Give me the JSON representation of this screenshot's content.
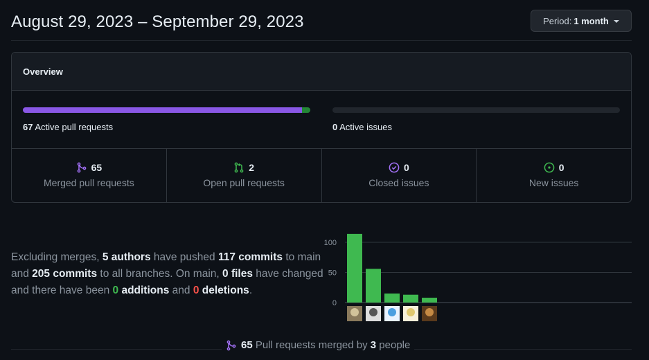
{
  "date_range": "August 29, 2023 – September 29, 2023",
  "period": {
    "prefix": "Period:",
    "value": "1 month"
  },
  "overview": {
    "title": "Overview",
    "pull_requests": {
      "count": "67",
      "label": "Active pull requests",
      "merged_fraction": 0.97,
      "open_fraction": 0.03
    },
    "issues": {
      "count": "0",
      "label": "Active issues"
    },
    "stats": [
      {
        "value": "65",
        "label": "Merged pull requests",
        "icon": "git-merge-icon",
        "color": "#a371f7"
      },
      {
        "value": "2",
        "label": "Open pull requests",
        "icon": "git-pull-request-icon",
        "color": "#3fb950"
      },
      {
        "value": "0",
        "label": "Closed issues",
        "icon": "issue-closed-icon",
        "color": "#a371f7"
      },
      {
        "value": "0",
        "label": "New issues",
        "icon": "issue-opened-icon",
        "color": "#3fb950"
      }
    ]
  },
  "summary": {
    "t1": "Excluding merges, ",
    "authors": "5 authors",
    "t2": " have pushed ",
    "commits_main": "117 commits",
    "t3": " to main and ",
    "commits_all": "205 commits",
    "t4": " to all branches. On main, ",
    "files": "0 files",
    "t5": " have changed and there have been ",
    "additions_num": "0",
    "additions_word": " additions",
    "t6": " and ",
    "deletions_num": "0",
    "deletions_word": " deletions",
    "t7": "."
  },
  "chart_data": {
    "type": "bar",
    "categories": [
      "author-1",
      "author-2",
      "author-3",
      "author-4",
      "author-5"
    ],
    "values": [
      114,
      56,
      15,
      13,
      8
    ],
    "ylim": [
      0,
      115
    ],
    "yticks": [
      "100",
      "50",
      "0"
    ],
    "ytick_values": [
      100,
      50,
      0
    ],
    "grid": true,
    "bar_color": "#3fb950"
  },
  "merged_summary": {
    "count": "65",
    "text1": " Pull requests merged by ",
    "people": "3",
    "text2": " people"
  },
  "colors": {
    "merged": "#8957e5",
    "open": "#238636",
    "track": "#21262d"
  }
}
